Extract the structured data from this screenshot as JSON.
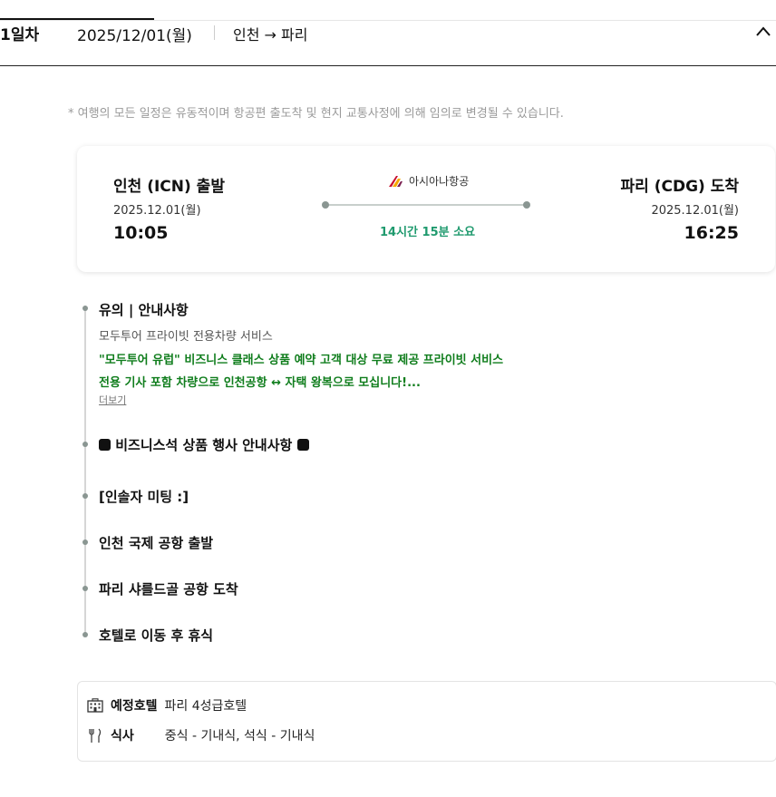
{
  "day": {
    "number": "1일차",
    "date": "2025/12/01(월)",
    "route": "인천 → 파리"
  },
  "notice": "* 여행의 모든 일정은 유동적이며 항공편 출도착 및 현지 교통사정에 의해 임의로 변경될 수 있습니다.",
  "flight": {
    "departure": {
      "title": "인천 (ICN) 출발",
      "date": "2025.12.01(월)",
      "time": "10:05"
    },
    "arrival": {
      "title": "파리 (CDG) 도착",
      "date": "2025.12.01(월)",
      "time": "16:25"
    },
    "airline": "아시아나항공",
    "duration": "14시간 15분 소요"
  },
  "timeline": {
    "notice_title": "유의 | 안내사항",
    "notice_sub": "모두투어 프라이빗 전용차량 서비스",
    "notice_line1": "\"모두투어 유럽\" 비즈니스 클래스 상품 예약 고객 대상 무료 제공 프라이빗 서비스",
    "notice_line2": "전용 기사 포함 차량으로 인천공항 ↔ 자택 왕복으로 모십니다!...",
    "more": "더보기",
    "event_title": "비즈니스석 상품 행사 안내사항",
    "items": [
      "[인솔자 미팅 :]",
      "인천 국제 공항 출발",
      "파리 샤를드골 공항 도착",
      "호텔로 이동 후 휴식"
    ]
  },
  "info": {
    "hotel_label": "예정호텔",
    "hotel_value": "파리 4성급호텔",
    "meal_label": "식사",
    "meal_value": "중식 - 기내식, 석식 - 기내식"
  },
  "colors": {
    "accent_green": "#1f9a6e",
    "highlight_green": "#0f7d1c"
  }
}
